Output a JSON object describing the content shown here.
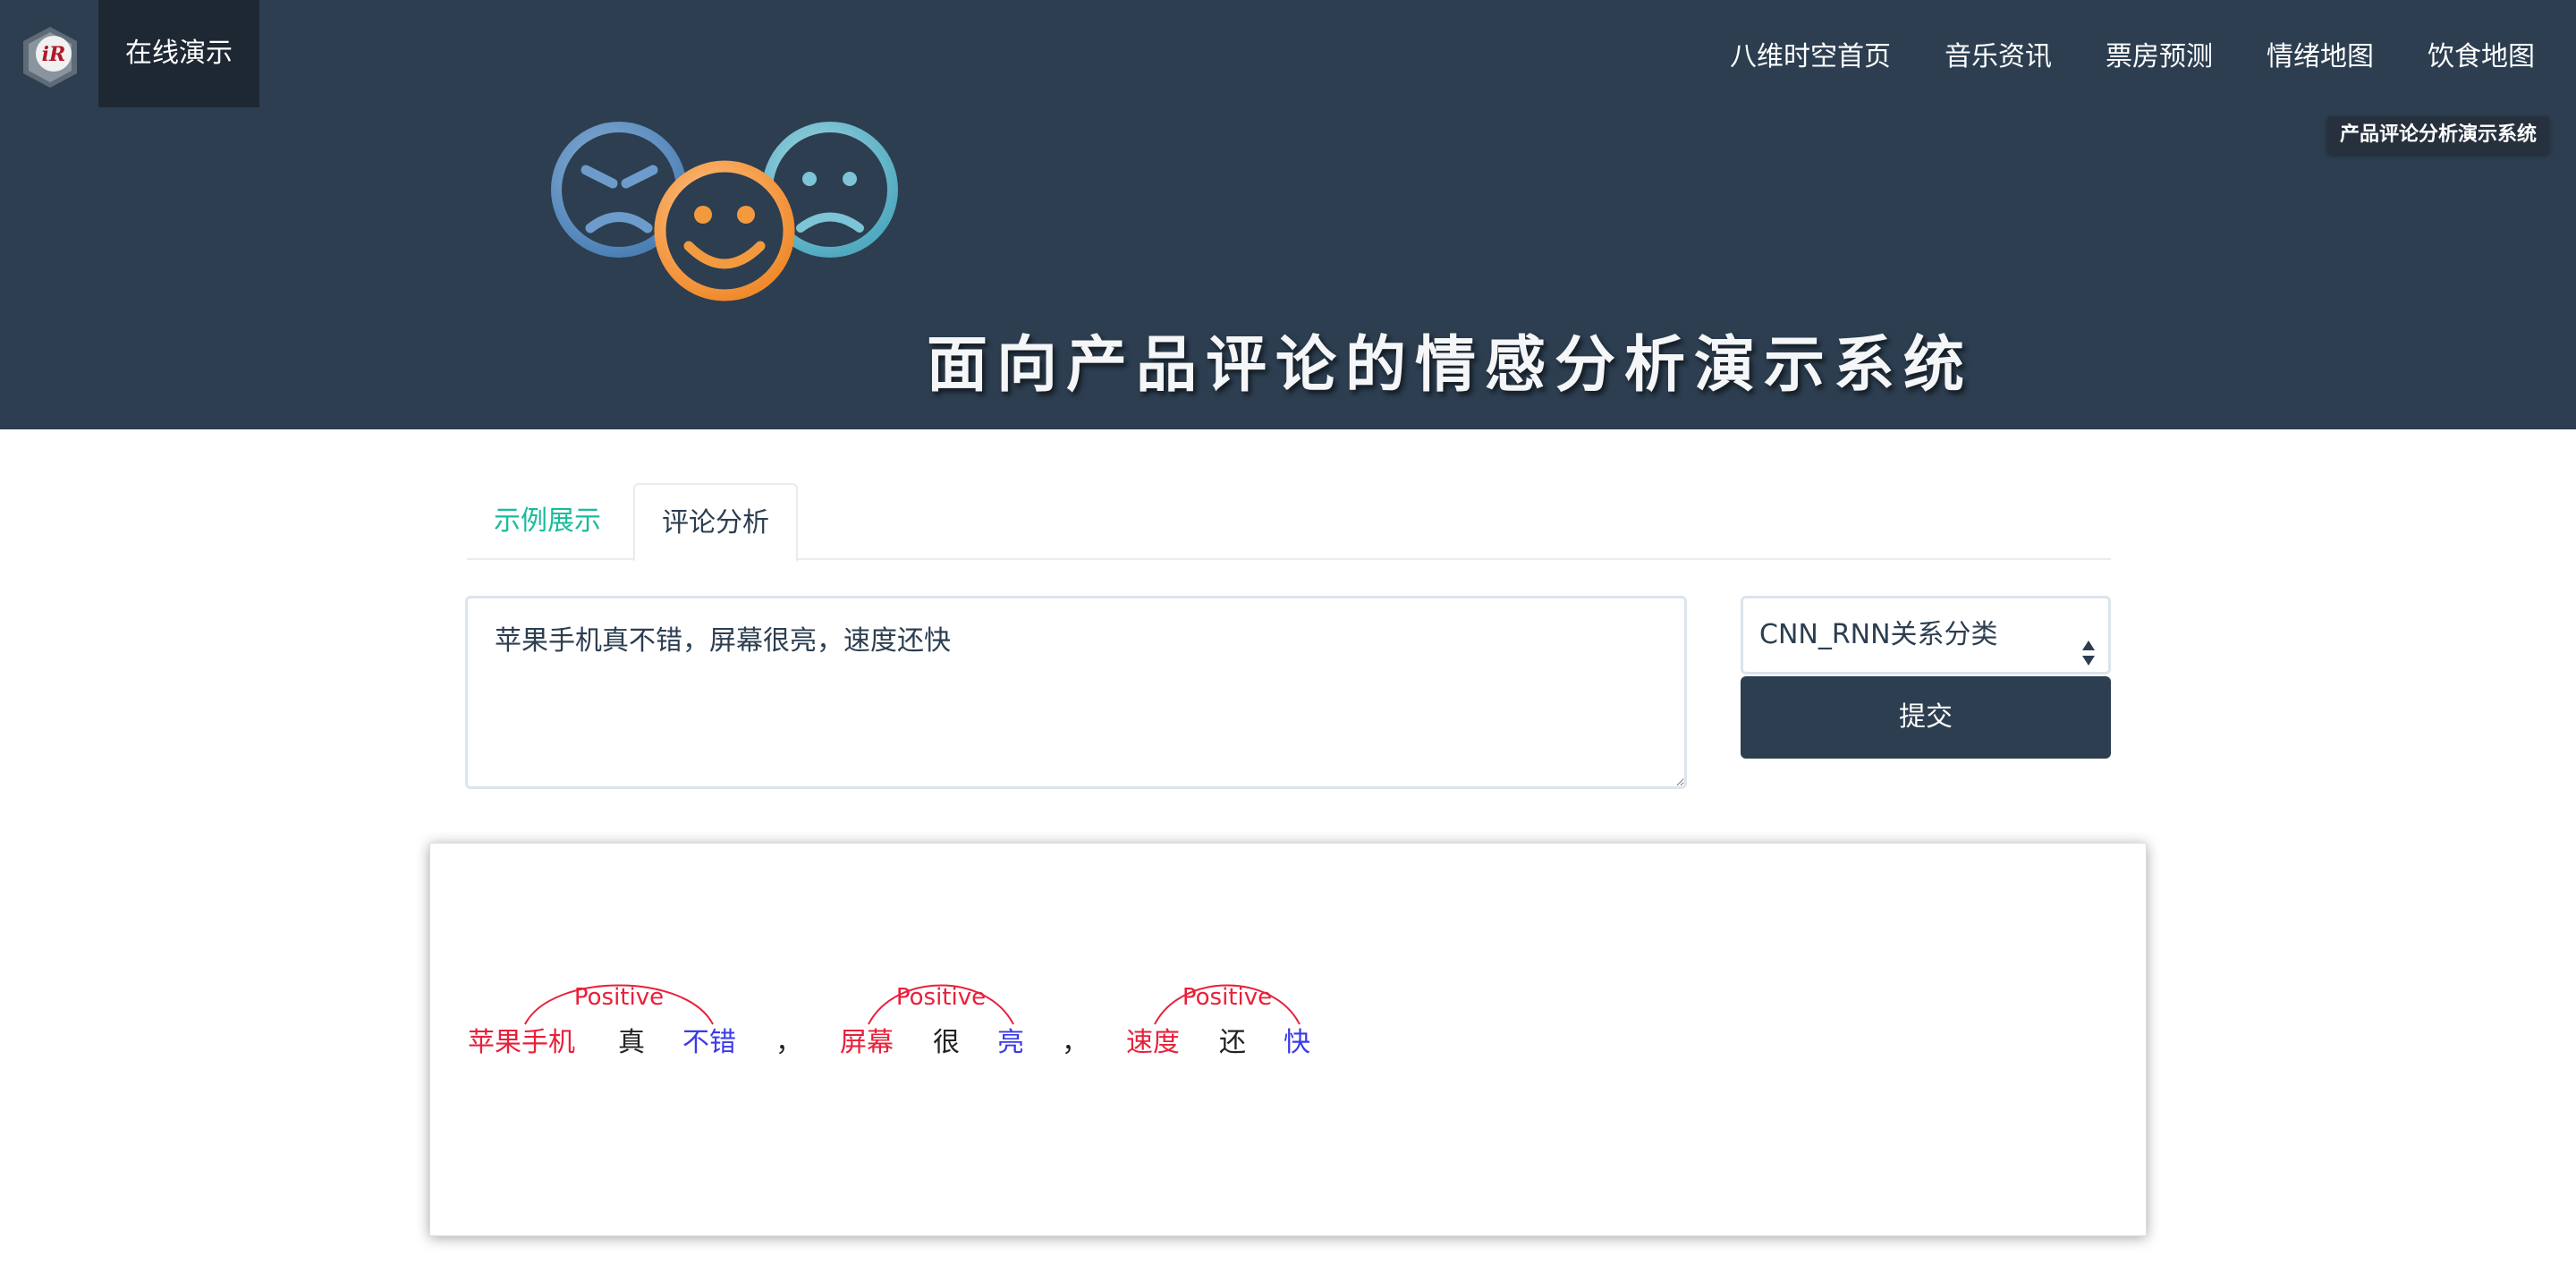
{
  "navbar": {
    "brand_label": "在线演示",
    "brand_logo_icon": "ir-lab-logo-icon",
    "items": [
      {
        "label": "八维时空首页"
      },
      {
        "label": "音乐资讯"
      },
      {
        "label": "票房预测"
      },
      {
        "label": "情绪地图"
      },
      {
        "label": "饮食地图"
      }
    ]
  },
  "header": {
    "badge": "产品评论分析演示系统",
    "title": "面向产品评论的情感分析演示系统",
    "faces_icon": "emotion-faces-icon"
  },
  "tabs": [
    {
      "label": "示例展示",
      "active": false
    },
    {
      "label": "评论分析",
      "active": true
    }
  ],
  "form": {
    "review_text": "苹果手机真不错，屏幕很亮，速度还快",
    "model_selected": "CNN_RNN关系分类",
    "submit_label": "提交"
  },
  "colors": {
    "header_bg": "#2c3e50",
    "brand_tab_bg": "#1e2833",
    "accent_teal": "#18bc9c",
    "aspect_red": "#e8203a",
    "opinion_blue": "#3a3ae8",
    "relation_red": "#e8203a"
  },
  "result": {
    "tokens": [
      {
        "text": "苹果手机",
        "role": "aspect"
      },
      {
        "text": "真",
        "role": "other"
      },
      {
        "text": "不错",
        "role": "opinion"
      },
      {
        "text": "，",
        "role": "punct"
      },
      {
        "text": "屏幕",
        "role": "aspect"
      },
      {
        "text": "很",
        "role": "other"
      },
      {
        "text": "亮",
        "role": "opinion"
      },
      {
        "text": "，",
        "role": "punct"
      },
      {
        "text": "速度",
        "role": "aspect"
      },
      {
        "text": "还",
        "role": "other"
      },
      {
        "text": "快",
        "role": "opinion"
      }
    ],
    "relations": [
      {
        "from": 0,
        "to": 2,
        "label": "Positive"
      },
      {
        "from": 4,
        "to": 6,
        "label": "Positive"
      },
      {
        "from": 8,
        "to": 10,
        "label": "Positive"
      }
    ]
  }
}
